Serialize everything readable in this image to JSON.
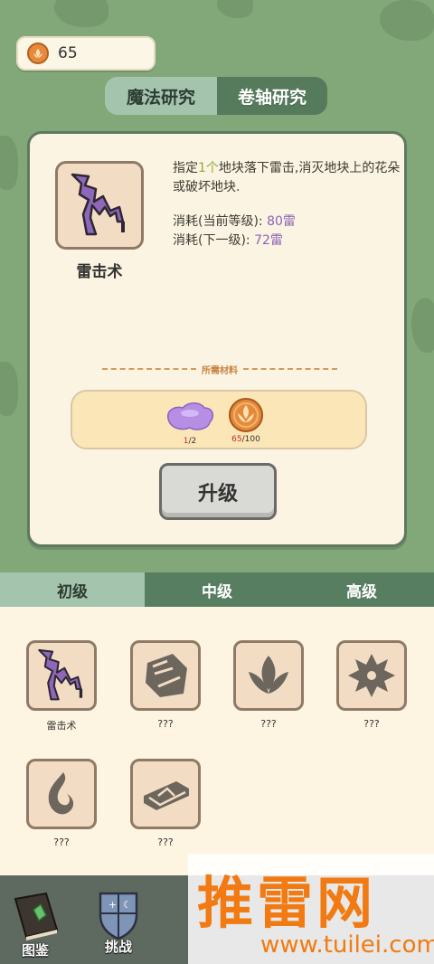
{
  "currency": {
    "amount": "65",
    "icon": "coin-icon"
  },
  "top_tabs": [
    {
      "label": "魔法研究",
      "active": true
    },
    {
      "label": "卷轴研究",
      "active": false
    }
  ],
  "spell": {
    "name": "雷击术",
    "icon": "lightning-icon",
    "desc_part1": "指定",
    "desc_highlight": "1个",
    "desc_part2": "地块落下雷击,消灭地块上的花朵或破坏地块.",
    "cost_current_label": "消耗(当前等级):",
    "cost_current_value": "80雷",
    "cost_next_label": "消耗(下一级):",
    "cost_next_value": "72雷"
  },
  "materials": {
    "title": "所需材料",
    "items": [
      {
        "icon": "purple-gem-icon",
        "have": "1",
        "need": "/2"
      },
      {
        "icon": "coin-icon",
        "have": "65",
        "need": "/100"
      }
    ]
  },
  "upgrade_label": "升级",
  "level_tabs": [
    {
      "label": "初级",
      "active": true
    },
    {
      "label": "中级",
      "active": false
    },
    {
      "label": "高级",
      "active": false
    }
  ],
  "spells_grid": [
    {
      "label": "雷击术",
      "icon": "lightning-icon"
    },
    {
      "label": "???",
      "icon": "rock-icon"
    },
    {
      "label": "???",
      "icon": "leaf-icon"
    },
    {
      "label": "???",
      "icon": "snowflake-icon"
    },
    {
      "label": "???",
      "icon": "flame-icon"
    },
    {
      "label": "???",
      "icon": "ingot-icon"
    }
  ],
  "bottom_nav": [
    {
      "label": "图鉴",
      "icon": "book-icon"
    },
    {
      "label": "挑战",
      "icon": "shield-icon"
    }
  ],
  "watermark": {
    "text": "推雷网",
    "url": "www.tuilei.com"
  }
}
